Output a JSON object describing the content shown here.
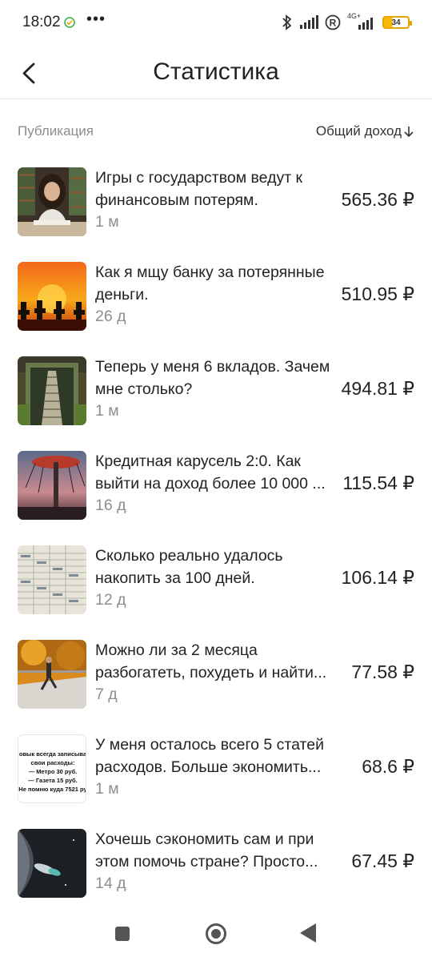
{
  "status_bar": {
    "time": "18:02",
    "network": "4G+",
    "battery": "34"
  },
  "header": {
    "title": "Статистика"
  },
  "columns": {
    "left": "Публикация",
    "right": "Общий доход",
    "sort_icon": "arrow-down-icon"
  },
  "items": [
    {
      "title": "Игры с государством ведут к финансовым потерям.",
      "age": "1 м",
      "income": "565.36 ₽",
      "thumb": "woman-reading-books"
    },
    {
      "title": "Как я мщу банку за потерянные деньги.",
      "age": "26 д",
      "income": "510.95 ₽",
      "thumb": "riders-at-sunset"
    },
    {
      "title": "Теперь у меня 6 вкладов. Зачем мне столько?",
      "age": "1 м",
      "income": "494.81 ₽",
      "thumb": "stone-staircase"
    },
    {
      "title": "Кредитная карусель 2:0. Как выйти на доход более 10 000 ...",
      "age": "16 д",
      "income": "115.54 ₽",
      "thumb": "swing-carousel"
    },
    {
      "title": "Сколько реально удалось накопить за 100 дней.",
      "age": "12 д",
      "income": "106.14 ₽",
      "thumb": "handwritten-table"
    },
    {
      "title": "Можно ли за 2 месяца разбогатеть, похудеть и найти...",
      "age": "7 д",
      "income": "77.58 ₽",
      "thumb": "runner-autumn"
    },
    {
      "title": "У меня осталось всего 5 статей расходов. Больше экономить...",
      "age": "1 м",
      "income": "68.6 ₽",
      "thumb": "expenses-note",
      "thumb_text": [
        "овык всегда записыва",
        "свои расходы:",
        "— Метро 30 руб.",
        "— Газета 15 руб.",
        "Не помню куда 7521 ру"
      ]
    },
    {
      "title": "Хочешь сэкономить сам и при этом помочь стране? Просто...",
      "age": "14 д",
      "income": "67.45 ₽",
      "thumb": "space-satellite"
    }
  ],
  "navbar": {
    "square": "recents-icon",
    "home": "home-icon",
    "back": "back-triangle-icon"
  },
  "colors": {
    "accent_battery": "#f6b800",
    "muted_text": "#8d8d8d",
    "text": "#222222"
  }
}
